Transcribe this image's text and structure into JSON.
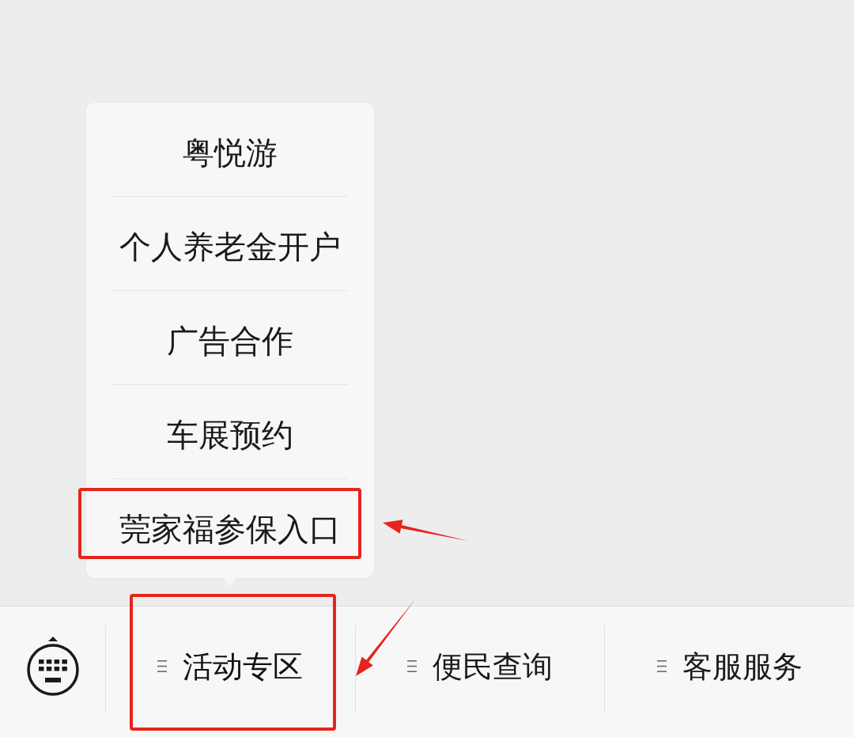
{
  "menu_tabs": [
    {
      "label": "活动专区",
      "expanded": true,
      "highlighted": true,
      "submenu": [
        {
          "label": "粤悦游",
          "highlighted": false
        },
        {
          "label": "个人养老金开户",
          "highlighted": false
        },
        {
          "label": "广告合作",
          "highlighted": false
        },
        {
          "label": "车展预约",
          "highlighted": false
        },
        {
          "label": "莞家福参保入口",
          "highlighted": true
        }
      ]
    },
    {
      "label": "便民查询",
      "expanded": false,
      "highlighted": false
    },
    {
      "label": "客服服务",
      "expanded": false,
      "highlighted": false
    }
  ]
}
